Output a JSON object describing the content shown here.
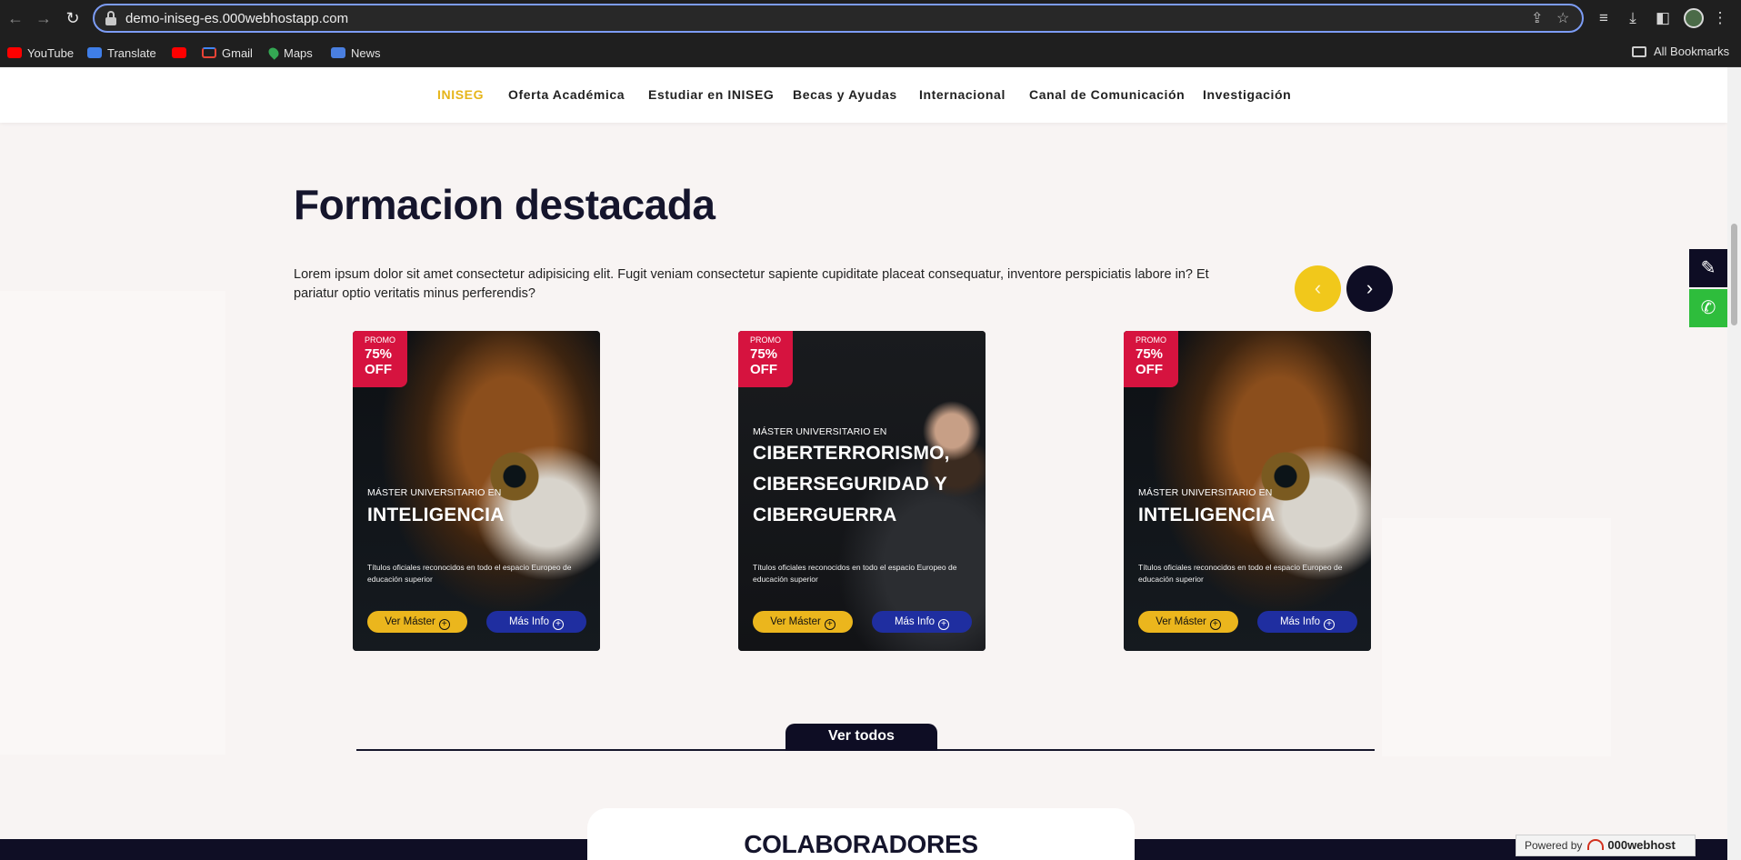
{
  "browser": {
    "url": "demo-iniseg-es.000webhostapp.com",
    "bookmarks": [
      {
        "label": "YouTube",
        "icon": "youtube-icon"
      },
      {
        "label": "Translate",
        "icon": "translate-icon"
      },
      {
        "label": "",
        "icon": "youtube-icon"
      },
      {
        "label": "Gmail",
        "icon": "gmail-icon"
      },
      {
        "label": "Maps",
        "icon": "maps-icon"
      },
      {
        "label": "News",
        "icon": "news-icon"
      }
    ],
    "all_bookmarks": "All Bookmarks"
  },
  "nav": {
    "items": [
      {
        "label": "INISEG",
        "active": true
      },
      {
        "label": "Oferta Académica"
      },
      {
        "label": "Estudiar en INISEG"
      },
      {
        "label": "Becas y Ayudas"
      },
      {
        "label": "Internacional"
      },
      {
        "label": "Canal de Comunicación"
      },
      {
        "label": "Investigación"
      }
    ]
  },
  "section": {
    "title": "Formacion destacada",
    "intro": "Lorem ipsum dolor sit amet consectetur adipisicing elit. Fugit veniam consectetur sapiente cupiditate placeat consequatur, inventore perspiciatis labore in? Et pariatur optio veritatis minus perferendis?"
  },
  "cards": [
    {
      "promo": "PROMO",
      "discount_line1": "75%",
      "discount_line2": "OFF",
      "kicker": "MÁSTER UNIVERSITARIO EN",
      "title_lines": [
        "INTELIGENCIA"
      ],
      "description": "Títulos oficiales reconocidos en todo el espacio Europeo de educación superior",
      "btn_primary": "Ver Máster",
      "btn_secondary": "Más Info"
    },
    {
      "promo": "PROMO",
      "discount_line1": "75%",
      "discount_line2": "OFF",
      "kicker": "MÁSTER UNIVERSITARIO EN",
      "title_lines": [
        "CIBERTERRORISMO,",
        "CIBERSEGURIDAD Y",
        "CIBERGUERRA"
      ],
      "description": "Títulos oficiales reconocidos en todo el espacio Europeo de educación superior",
      "btn_primary": "Ver Máster",
      "btn_secondary": "Más Info"
    },
    {
      "promo": "PROMO",
      "discount_line1": "75%",
      "discount_line2": "OFF",
      "kicker": "MÁSTER UNIVERSITARIO EN",
      "title_lines": [
        "INTELIGENCIA"
      ],
      "description": "Títulos oficiales reconocidos en todo el espacio Europeo de educación superior",
      "btn_primary": "Ver Máster",
      "btn_secondary": "Más Info"
    }
  ],
  "ver_todos": "Ver todos",
  "colaboradores": "COLABORADORES",
  "powered_by": {
    "prefix": "Powered by",
    "brand": "000webhost"
  },
  "colors": {
    "accent": "#e6b51a",
    "navy": "#0e0d24",
    "promo_red": "#d6133f",
    "info_blue": "#1f2ea0",
    "whatsapp": "#2ebd3c"
  }
}
